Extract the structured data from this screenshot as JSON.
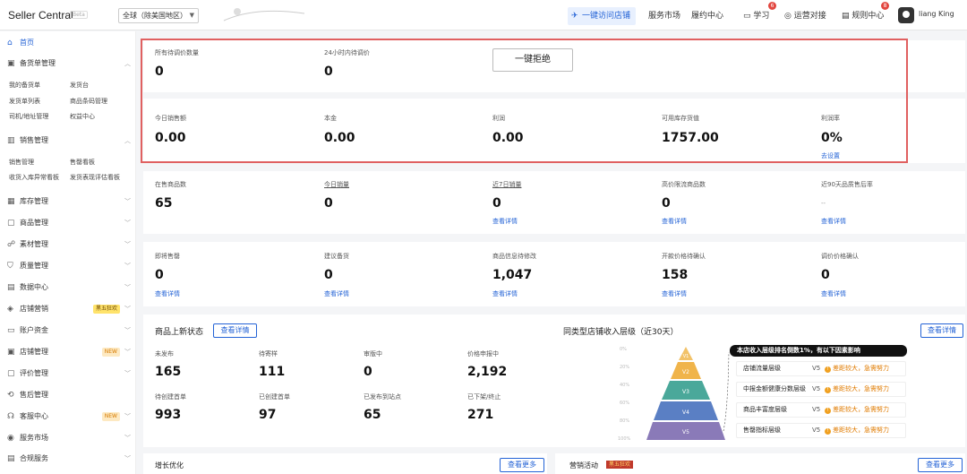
{
  "header": {
    "brand": "Seller Central",
    "beta": "Beta",
    "region": "全球（除美国地区）",
    "visit_store": "一键访问店铺",
    "service_market": "服务市场",
    "fulfillment": "履约中心",
    "learn": "学习",
    "learn_badge": "6",
    "operations": "运营对接",
    "rules": "规则中心",
    "rules_badge": "8",
    "user": "liang King"
  },
  "sidebar": {
    "home": "首页",
    "stock_mgmt": "备货单管理",
    "stock_sub": [
      "我的备货单",
      "发货台",
      "发货单列表",
      "商品条码管理",
      "司机/地址管理",
      "权益中心"
    ],
    "sales_mgmt": "销售管理",
    "sales_sub": [
      "销售管理",
      "售罄看板",
      "收货入库异常看板",
      "发货表现评估看板"
    ],
    "items": [
      "库存管理",
      "商品管理",
      "素材管理",
      "质量管理",
      "数据中心",
      "店铺营销",
      "账户资金",
      "店铺管理",
      "评价管理",
      "售后管理",
      "客服中心",
      "服务市场",
      "合规服务"
    ],
    "tag_marketing": "黑五狂欢",
    "tag_new": "NEW"
  },
  "pricing": {
    "pending_label": "所有待调价数量",
    "pending_value": "0",
    "pending24_label": "24小时内待调价",
    "pending24_value": "0",
    "reject_button": "一键拒绝"
  },
  "sales": {
    "today_label": "今日销售额",
    "today_value": "0.00",
    "cost_label": "本金",
    "cost_value": "0.00",
    "profit_label": "利润",
    "profit_value": "0.00",
    "inventory_label": "可用库存货值",
    "inventory_value": "1757.00",
    "margin_label": "利润率",
    "margin_value": "0%",
    "margin_link": "去设置"
  },
  "stats1": {
    "onsale_label": "在售商品数",
    "onsale_value": "65",
    "todaysales_label": "今日销量",
    "todaysales_value": "0",
    "week_label": "近7日销量",
    "week_value": "0",
    "highprice_label": "高价限流商品数",
    "highprice_value": "0",
    "quality_label": "近90天品质售后率",
    "quality_value": "--",
    "detail": "查看详情"
  },
  "stats2": {
    "soldout_label": "即将售罄",
    "soldout_value": "0",
    "restock_label": "建议备货",
    "restock_value": "0",
    "info_label": "商品信息待修改",
    "info_value": "1,047",
    "newprice_label": "开款价格待确认",
    "newprice_value": "158",
    "adjust_label": "调价价格确认",
    "adjust_value": "0",
    "detail": "查看详情"
  },
  "listing": {
    "title": "商品上新状态",
    "button": "查看详情",
    "unpublished_label": "未发布",
    "unpublished_value": "165",
    "pending_label": "待寄样",
    "pending_value": "111",
    "review_label": "审版中",
    "review_value": "0",
    "price_label": "价格申报中",
    "price_value": "2,192",
    "tocreate_label": "待创建首单",
    "tocreate_value": "993",
    "created_label": "已创建首单",
    "created_value": "97",
    "published_label": "已发布到站点",
    "published_value": "65",
    "delisted_label": "已下架/终止",
    "delisted_value": "271"
  },
  "tier": {
    "title": "同类型店铺收入层级（近30天）",
    "button": "查看详情",
    "axis": [
      "0%",
      "20%",
      "40%",
      "60%",
      "80%",
      "100%"
    ],
    "levels": [
      "V1",
      "V2",
      "V3",
      "V4",
      "V5"
    ],
    "note": "本店收入层级排名倒数1%，有以下因素影响",
    "rows": [
      {
        "name": "店铺流量层级",
        "level": "V5",
        "warn": "差距较大，急需努力"
      },
      {
        "name": "中报金额健康分数层级",
        "level": "V5",
        "warn": "差距较大，急需努力"
      },
      {
        "name": "商品丰富度层级",
        "level": "V5",
        "warn": "差距较大，急需努力"
      },
      {
        "name": "售罄指标层级",
        "level": "V5",
        "warn": "差距较大，急需努力"
      }
    ],
    "colors": [
      "#f2c268",
      "#f0b44a",
      "#4aa89a",
      "#5a7fc4",
      "#8a7ab8"
    ]
  },
  "bottom": {
    "growth_title": "增长优化",
    "more": "查看更多",
    "marketing_title": "营销活动",
    "marketing_tag": "黑五狂欢"
  }
}
